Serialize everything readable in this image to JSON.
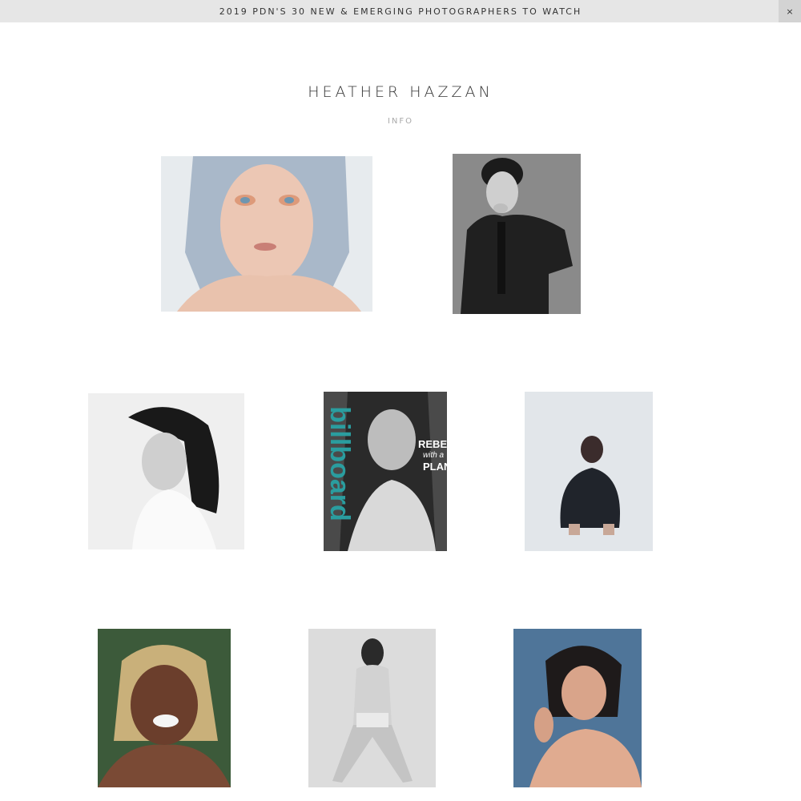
{
  "banner": {
    "text": "2019 PDN'S 30 NEW & EMERGING PHOTOGRAPHERS TO WATCH",
    "close_label": "×"
  },
  "header": {
    "title": "HEATHER HAZZAN",
    "info_label": "INFO"
  },
  "gallery": {
    "cover": {
      "masthead": "billboard",
      "headline_1": "REBEL",
      "headline_2": "with a",
      "headline_3": "PLAN",
      "accent_color": "#2a9d9f"
    },
    "colors": {
      "row1_left_bg": "#e7ebee",
      "row1_right_bg": "#8a8a8a",
      "row2_left_bg": "#efefef",
      "row2_right_bg": "#e2e6ea",
      "row3_left_bg": "#3c5a3a",
      "row3_mid_bg": "#dcdcdc",
      "row3_right_bg": "#4f7599"
    }
  }
}
